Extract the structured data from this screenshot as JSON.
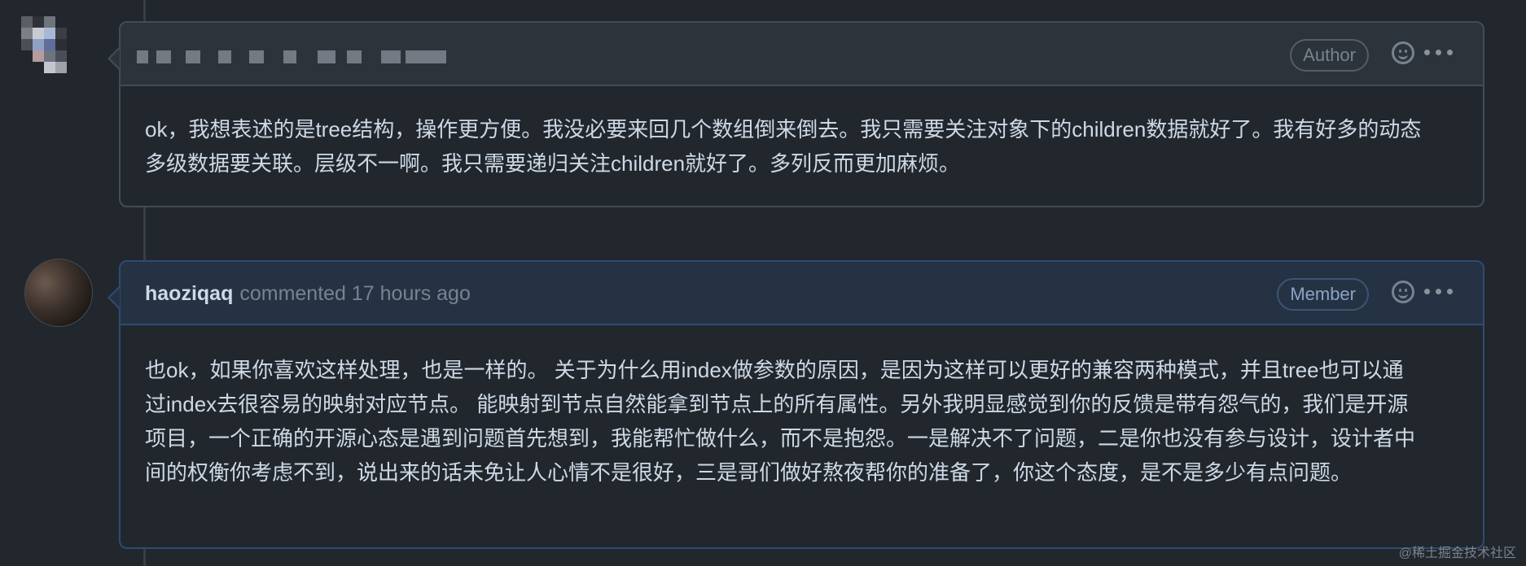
{
  "comments": [
    {
      "author_redacted": true,
      "badge": "Author",
      "body": "ok，我想表述的是tree结构，操作更方便。我没必要来回几个数组倒来倒去。我只需要关注对象下的children数据就好了。我有好多的动态多级数据要关联。层级不一啊。我只需要递归关注children就好了。多列反而更加麻烦。"
    },
    {
      "author": "haoziqaq",
      "meta": "commented 17 hours ago",
      "badge": "Member",
      "body": "也ok，如果你喜欢这样处理，也是一样的。 关于为什么用index做参数的原因，是因为这样可以更好的兼容两种模式，并且tree也可以通过index去很容易的映射对应节点。 能映射到节点自然能拿到节点上的所有属性。另外我明显感觉到你的反馈是带有怨气的，我们是开源项目，一个正确的开源心态是遇到问题首先想到，我能帮忙做什么，而不是抱怨。一是解决不了问题，二是你也没有参与设计，设计者中间的权衡你考虑不到，说出来的话未免让人心情不是很好，三是哥们做好熬夜帮你的准备了，你这个态度，是不是多少有点问题。"
    }
  ],
  "watermark": "@稀土掘金技术社区",
  "colors": {
    "background": "#22272e",
    "border": "#444c56",
    "member_border": "#2e4b73",
    "text": "#cdd9e5",
    "muted": "#768390"
  },
  "icons": {
    "reaction": "smiley-icon",
    "more": "kebab-horizontal-icon"
  }
}
